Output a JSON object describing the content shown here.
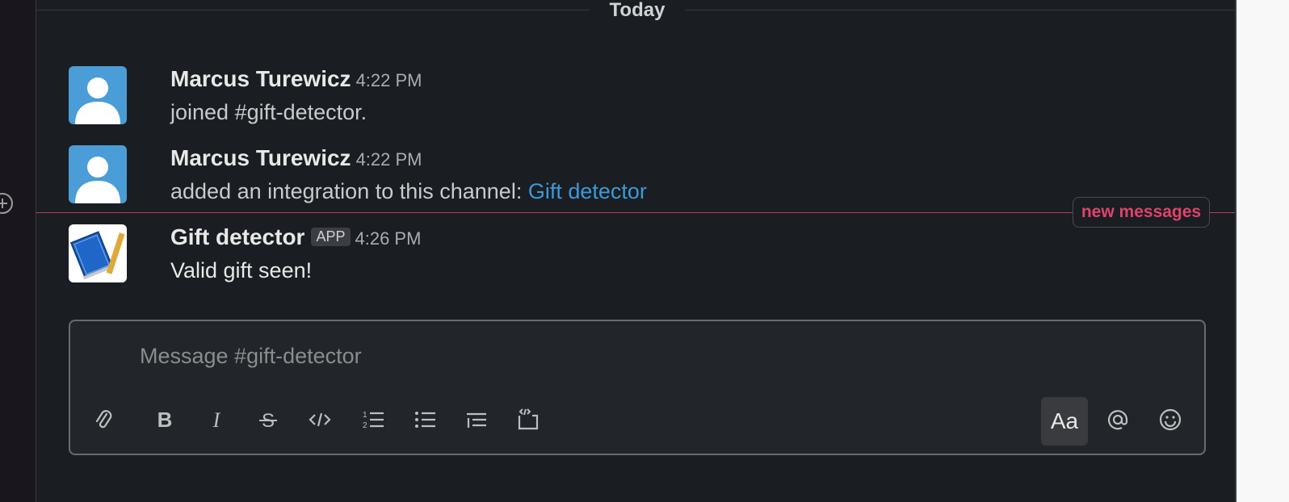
{
  "divider": {
    "label": "Today"
  },
  "messages": [
    {
      "author": "Marcus Turewicz",
      "time": "4:22 PM",
      "text": "joined #gift-detector."
    },
    {
      "author": "Marcus Turewicz",
      "time": "4:22 PM",
      "text_prefix": "added an integration to this channel: ",
      "link": "Gift detector"
    },
    {
      "author": "Gift detector",
      "badge": "APP",
      "time": "4:26 PM",
      "text": "Valid gift seen!"
    }
  ],
  "new_messages_label": "new messages",
  "composer": {
    "placeholder": "Message #gift-detector",
    "format_label": "Aa"
  },
  "icons": {
    "attach": "paperclip-icon",
    "bold": "bold-icon",
    "italic": "italic-icon",
    "strike": "strikethrough-icon",
    "code": "code-icon",
    "ordered": "ordered-list-icon",
    "bullet": "bulleted-list-icon",
    "blockquote": "blockquote-icon",
    "codeblock": "code-block-icon",
    "mention": "at-icon",
    "emoji": "emoji-icon"
  },
  "colors": {
    "link": "#3a9ad9",
    "new_messages": "#e0436a",
    "avatar_default": "#4a9dd6"
  }
}
